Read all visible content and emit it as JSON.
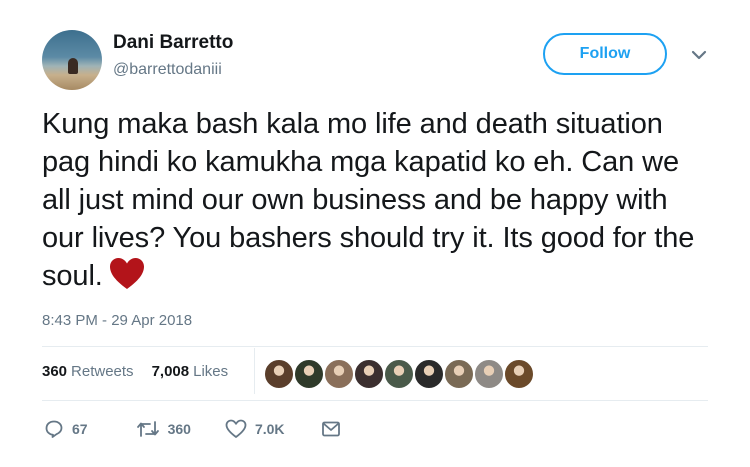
{
  "tweet": {
    "author_name": "Dani Barretto",
    "author_handle": "@barrettodaniii",
    "follow_label": "Follow",
    "text": "Kung maka bash kala mo life and death situation pag hindi ko kamukha mga kapatid ko eh. Can we all just mind our own business and be happy with our lives? You bashers should try it. Its good for the soul.",
    "timestamp": "8:43 PM - 29 Apr 2018",
    "retweets_count": "360",
    "retweets_label": "Retweets",
    "likes_count": "7,008",
    "likes_label": "Likes",
    "icons": {
      "caret": "chevron-down-icon",
      "emoji": "heart-emoji",
      "reply": "reply-icon",
      "retweet": "retweet-icon",
      "like": "heart-icon",
      "dm": "envelope-icon"
    }
  },
  "liker_avatars": [
    {
      "color": "#5a3e2b"
    },
    {
      "color": "#2f3a2a"
    },
    {
      "color": "#8a6f5a"
    },
    {
      "color": "#3b2f2f"
    },
    {
      "color": "#4a5a4a"
    },
    {
      "color": "#2a2a2a"
    },
    {
      "color": "#7a6a55"
    },
    {
      "color": "#8e8a86"
    },
    {
      "color": "#6b4a2a"
    }
  ],
  "actions": {
    "reply_count": "67",
    "retweet_count": "360",
    "like_count": "7.0K"
  },
  "colors": {
    "accent": "#1da1f2",
    "text": "#14171a",
    "muted": "#657786",
    "heart_emoji": "#b3141a"
  }
}
